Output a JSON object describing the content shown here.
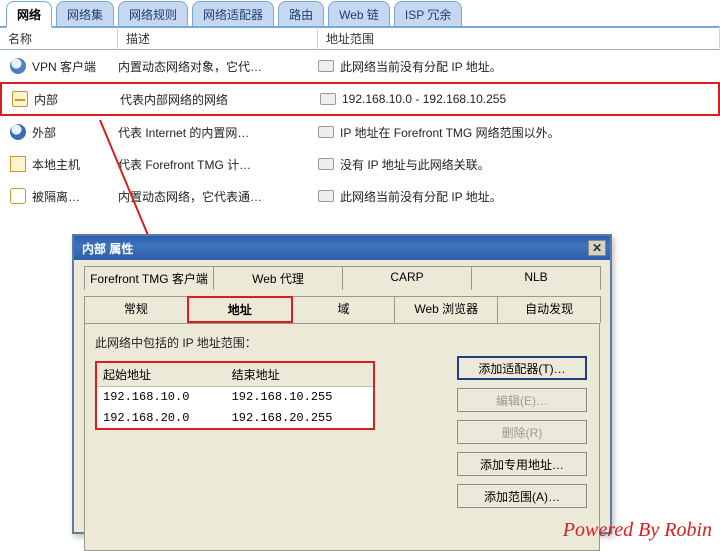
{
  "main_tabs": [
    {
      "id": "network",
      "label": "网络",
      "active": true
    },
    {
      "id": "network-sets",
      "label": "网络集",
      "active": false
    },
    {
      "id": "network-rules",
      "label": "网络规则",
      "active": false
    },
    {
      "id": "network-adapters",
      "label": "网络适配器",
      "active": false
    },
    {
      "id": "routing",
      "label": "路由",
      "active": false
    },
    {
      "id": "web-chain",
      "label": "Web 链",
      "active": false
    },
    {
      "id": "isp-redundancy",
      "label": "ISP 冗余",
      "active": false
    }
  ],
  "columns": {
    "name": "名称",
    "desc": "描述",
    "range": "地址范围"
  },
  "networks": [
    {
      "id": "vpn-clients",
      "name": "VPN 客户端",
      "desc": "内置动态网络对象，它代…",
      "range": "此网络当前没有分配 IP 地址。",
      "icon": "globe",
      "selected": false
    },
    {
      "id": "internal",
      "name": "内部",
      "desc": "代表内部网络的网络",
      "range": "192.168.10.0 - 192.168.10.255",
      "icon": "internal",
      "selected": true
    },
    {
      "id": "external",
      "name": "外部",
      "desc": "代表 Internet 的内置网…",
      "range": "IP 地址在 Forefront TMG 网络范围以外。",
      "icon": "external",
      "selected": false
    },
    {
      "id": "localhost",
      "name": "本地主机",
      "desc": "代表 Forefront TMG 计…",
      "range": "没有 IP 地址与此网络关联。",
      "icon": "host",
      "selected": false
    },
    {
      "id": "quarantined",
      "name": "被隔离…",
      "desc": "内置动态网络，它代表通…",
      "range": "此网络当前没有分配 IP 地址。",
      "icon": "quarantine",
      "selected": false
    }
  ],
  "dialog": {
    "title": "内部 属性",
    "tabs_row1": [
      {
        "id": "tmg-client",
        "label": "Forefront TMG 客户端"
      },
      {
        "id": "web-proxy",
        "label": "Web 代理"
      },
      {
        "id": "carp",
        "label": "CARP"
      },
      {
        "id": "nlb",
        "label": "NLB"
      }
    ],
    "tabs_row2": [
      {
        "id": "general",
        "label": "常规"
      },
      {
        "id": "addresses",
        "label": "地址",
        "active": true
      },
      {
        "id": "domains",
        "label": "域"
      },
      {
        "id": "web-browser",
        "label": "Web 浏览器"
      },
      {
        "id": "autodiscover",
        "label": "自动发现"
      }
    ],
    "panel_caption": "此网络中包括的 IP 地址范围：",
    "addr_headers": {
      "start": "起始地址",
      "end": "结束地址"
    },
    "addr_rows": [
      {
        "start": "192.168.10.0",
        "end": "192.168.10.255"
      },
      {
        "start": "192.168.20.0",
        "end": "192.168.20.255"
      }
    ],
    "buttons": {
      "add_adapter": "添加适配器(T)…",
      "edit": "编辑(E)…",
      "remove": "删除(R)",
      "add_dedicated": "添加专用地址…",
      "add_range": "添加范围(A)…"
    }
  },
  "watermark": "Powered By Robin"
}
